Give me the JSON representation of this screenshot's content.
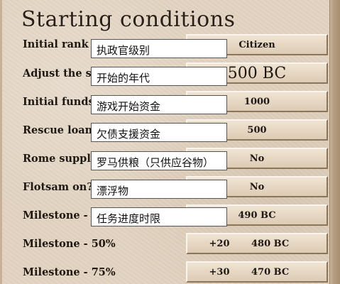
{
  "title": "Starting conditions",
  "rows": [
    {
      "label": "Initial rank",
      "value": "Citizen",
      "tooltip": "执政官级别"
    },
    {
      "label": "Adjust the st",
      "value": "500 BC",
      "tooltip": "开始的年代"
    },
    {
      "label": "Initial funds",
      "value": "1000",
      "tooltip": "游戏开始资金"
    },
    {
      "label": "Rescue loan",
      "value": "500",
      "tooltip": "欠债支援资金"
    },
    {
      "label": "Rome suppli",
      "value": "No",
      "tooltip": "罗马供粮（只供应谷物）"
    },
    {
      "label": "Flotsam on?",
      "value": "No",
      "tooltip": "漂浮物"
    },
    {
      "label": "Milestone - 2",
      "value": "490 BC",
      "tooltip": "任务进度时限"
    }
  ],
  "milestones": [
    {
      "label": "Milestone - 50%",
      "increment": "+20",
      "year": "480 BC"
    },
    {
      "label": "Milestone - 75%",
      "increment": "+30",
      "year": "470 BC"
    }
  ]
}
